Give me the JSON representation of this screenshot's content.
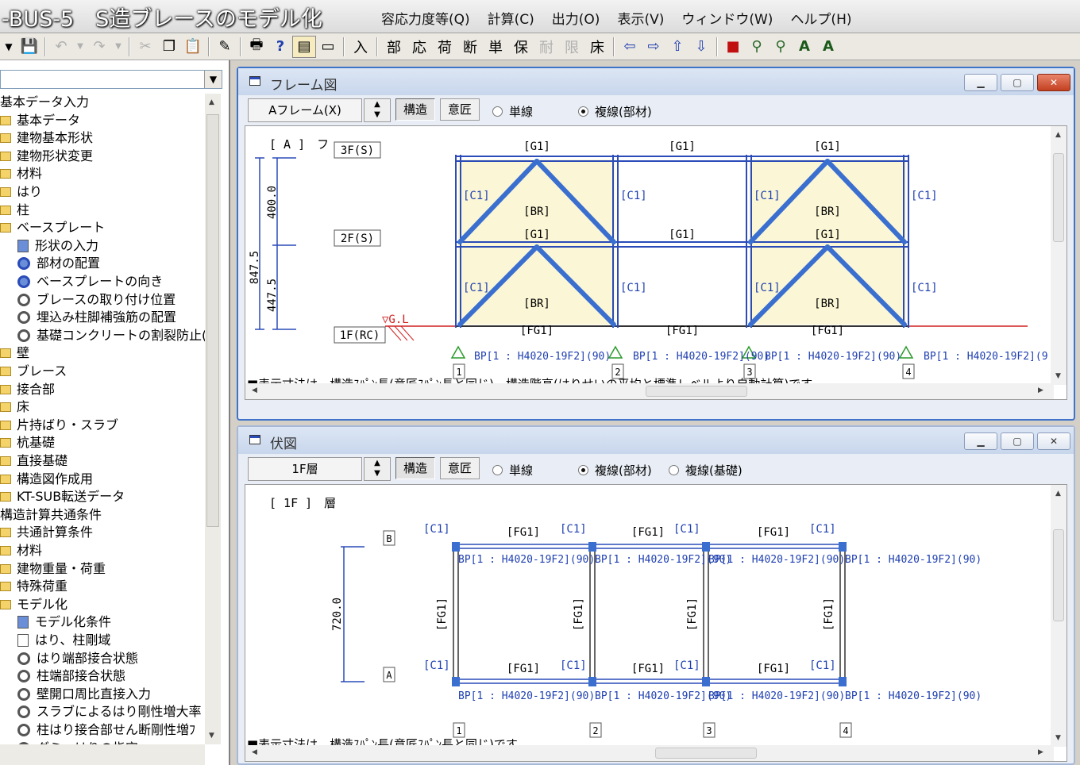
{
  "app": {
    "title": "-BUS-5　S造ブレースのモデル化"
  },
  "menu": [
    "容応力度等(Q)",
    "計算(C)",
    "出力(O)",
    "表示(V)",
    "ウィンドウ(W)",
    "ヘルプ(H)"
  ],
  "toolbar": {
    "chars": [
      "入",
      "部",
      "応",
      "荷",
      "断",
      "単",
      "保",
      "耐",
      "限",
      "床"
    ]
  },
  "tree": {
    "items": [
      {
        "label": "基本データ入力",
        "indent": 0,
        "icon": "none"
      },
      {
        "label": "基本データ",
        "indent": 0,
        "icon": "folder"
      },
      {
        "label": "建物基本形状",
        "indent": 0,
        "icon": "folder"
      },
      {
        "label": "建物形状変更",
        "indent": 0,
        "icon": "folder"
      },
      {
        "label": "材料",
        "indent": 0,
        "icon": "folder"
      },
      {
        "label": "はり",
        "indent": 0,
        "icon": "folder"
      },
      {
        "label": "柱",
        "indent": 0,
        "icon": "folder"
      },
      {
        "label": "ベースプレート",
        "indent": 0,
        "icon": "folder-open"
      },
      {
        "label": "形状の入力",
        "indent": 1,
        "icon": "doc-blue"
      },
      {
        "label": "部材の配置",
        "indent": 1,
        "icon": "gear-blue"
      },
      {
        "label": "ベースプレートの向き",
        "indent": 1,
        "icon": "gear-blue"
      },
      {
        "label": "ブレースの取り付け位置",
        "indent": 1,
        "icon": "gear"
      },
      {
        "label": "埋込み柱脚補強筋の配置",
        "indent": 1,
        "icon": "gear"
      },
      {
        "label": "基礎コンクリートの割裂防止(",
        "indent": 1,
        "icon": "gear"
      },
      {
        "label": "壁",
        "indent": 0,
        "icon": "folder"
      },
      {
        "label": "ブレース",
        "indent": 0,
        "icon": "folder"
      },
      {
        "label": "接合部",
        "indent": 0,
        "icon": "folder"
      },
      {
        "label": "床",
        "indent": 0,
        "icon": "folder"
      },
      {
        "label": "片持ばり・スラブ",
        "indent": 0,
        "icon": "folder"
      },
      {
        "label": "杭基礎",
        "indent": 0,
        "icon": "folder"
      },
      {
        "label": "直接基礎",
        "indent": 0,
        "icon": "folder"
      },
      {
        "label": "構造図作成用",
        "indent": 0,
        "icon": "folder"
      },
      {
        "label": "KT-SUB転送データ",
        "indent": 0,
        "icon": "folder"
      },
      {
        "label": "構造計算共通条件",
        "indent": 0,
        "icon": "none"
      },
      {
        "label": "共通計算条件",
        "indent": 0,
        "icon": "folder"
      },
      {
        "label": "材料",
        "indent": 0,
        "icon": "folder"
      },
      {
        "label": "建物重量・荷重",
        "indent": 0,
        "icon": "folder"
      },
      {
        "label": "特殊荷重",
        "indent": 0,
        "icon": "folder"
      },
      {
        "label": "モデル化",
        "indent": 0,
        "icon": "folder-open"
      },
      {
        "label": "モデル化条件",
        "indent": 1,
        "icon": "doc-blue"
      },
      {
        "label": "はり、柱剛域",
        "indent": 1,
        "icon": "doc"
      },
      {
        "label": "はり端部接合状態",
        "indent": 1,
        "icon": "gear"
      },
      {
        "label": "柱端部接合状態",
        "indent": 1,
        "icon": "gear"
      },
      {
        "label": "壁開口周比直接入力",
        "indent": 1,
        "icon": "gear"
      },
      {
        "label": "スラブによるはり剛性増大率",
        "indent": 1,
        "icon": "gear"
      },
      {
        "label": "柱はり接合部せん断剛性増ﾌ",
        "indent": 1,
        "icon": "gear"
      },
      {
        "label": "ダミーはりの指定",
        "indent": 1,
        "icon": "gear"
      }
    ]
  },
  "frame_window": {
    "title": "フレーム図",
    "selector": "Aフレーム(X)",
    "mode_struct": "構造",
    "mode_design": "意匠",
    "radio_single": "単線",
    "radio_double": "複線(部材)",
    "header_label": "[ A ]　フ",
    "dim_total": "847.5",
    "dim_upper": "400.0",
    "dim_lower": "447.5",
    "floor_3f": "3F(S)",
    "floor_2f": "2F(S)",
    "floor_1f": "1F(RC)",
    "gl": "▽G.L",
    "girder": "[G1]",
    "column": "[C1]",
    "brace": "[BR]",
    "foundation_girder": "[FG1]",
    "base_plate": "BP[1 : H4020-19F2](90)",
    "base_plate_cut": "BP[1 : H4020-19F2](9",
    "axes": [
      "1",
      "2",
      "3",
      "4"
    ],
    "note": "■表示寸法は、構造ｽﾊﾟﾝ長(意匠ｽﾊﾟﾝ長と同じ)、構造階高(はりせいの平均と標準レベルより自動計算)です。"
  },
  "plan_window": {
    "title": "伏図",
    "selector": "1F層",
    "mode_struct": "構造",
    "mode_design": "意匠",
    "radio_single": "単線",
    "radio_double": "複線(部材)",
    "radio_foundation": "複線(基礎)",
    "header_label": "[ 1F ]　層",
    "dim_span": "720.0",
    "axis_b": "B",
    "axis_a": "A",
    "column": "[C1]",
    "foundation_girder": "[FG1]",
    "base_plate": "BP[1 : H4020-19F2](90)",
    "axes": [
      "1",
      "2",
      "3",
      "4"
    ],
    "note": "■表示寸法は、構造ｽﾊﾟﾝ長(意匠ｽﾊﾟﾝ長と同じ)です。"
  },
  "colors": {
    "member_blue": "#2a4bb8",
    "label_blue": "#1e3fb0",
    "bay_fill": "#fbf7d6",
    "gl_red": "#d02020",
    "support_green": "#2a9a2a",
    "title_border": "#3f72c9"
  }
}
